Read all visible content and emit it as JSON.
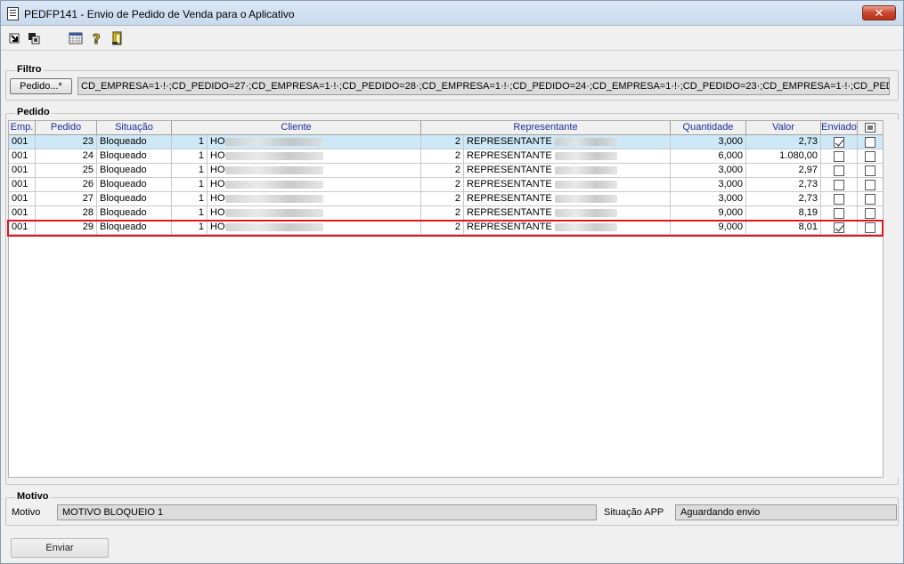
{
  "window": {
    "title": "PEDFP141 - Envio de Pedido de Venda para o Aplicativo",
    "close_label": "✕"
  },
  "toolbar": {
    "icons": [
      "arrow-in-icon",
      "copy-icon",
      "calendar-grid-icon",
      "help-icon",
      "exit-door-icon"
    ]
  },
  "filtro": {
    "group_label": "Filtro",
    "button_label": "Pedido...*",
    "value": "CD_EMPRESA=1·!·;CD_PEDIDO=27·;CD_EMPRESA=1·!·;CD_PEDIDO=28·;CD_EMPRESA=1·!·;CD_PEDIDO=24·;CD_EMPRESA=1·!·;CD_PEDIDO=23·;CD_EMPRESA=1·!·;CD_PEDIDO=26·;CD_EMI"
  },
  "pedido": {
    "group_label": "Pedido",
    "columns": [
      "Emp.",
      "Pedido",
      "Situação",
      "Cliente",
      "Representante",
      "Quantidade",
      "Valor",
      "Enviado",
      ""
    ],
    "rows": [
      {
        "emp": "001",
        "pedido": "23",
        "situacao": "Bloqueado",
        "cliente_cod": "1",
        "cliente_nome": "HO",
        "rep_cod": "2",
        "rep_nome": "REPRESENTANTE ",
        "quantidade": "3,000",
        "valor": "2,73",
        "enviado": true,
        "selecionado": false
      },
      {
        "emp": "001",
        "pedido": "24",
        "situacao": "Bloqueado",
        "cliente_cod": "1",
        "cliente_nome": "HO",
        "rep_cod": "2",
        "rep_nome": "REPRESENTANTE ",
        "quantidade": "6,000",
        "valor": "1.080,00",
        "enviado": false,
        "selecionado": false
      },
      {
        "emp": "001",
        "pedido": "25",
        "situacao": "Bloqueado",
        "cliente_cod": "1",
        "cliente_nome": "HO",
        "rep_cod": "2",
        "rep_nome": "REPRESENTANTE ",
        "quantidade": "3,000",
        "valor": "2,97",
        "enviado": false,
        "selecionado": false
      },
      {
        "emp": "001",
        "pedido": "26",
        "situacao": "Bloqueado",
        "cliente_cod": "1",
        "cliente_nome": "HO",
        "rep_cod": "2",
        "rep_nome": "REPRESENTANTE ",
        "quantidade": "3,000",
        "valor": "2,73",
        "enviado": false,
        "selecionado": false
      },
      {
        "emp": "001",
        "pedido": "27",
        "situacao": "Bloqueado",
        "cliente_cod": "1",
        "cliente_nome": "HO",
        "rep_cod": "2",
        "rep_nome": "REPRESENTANTE ",
        "quantidade": "3,000",
        "valor": "2,73",
        "enviado": false,
        "selecionado": false
      },
      {
        "emp": "001",
        "pedido": "28",
        "situacao": "Bloqueado",
        "cliente_cod": "1",
        "cliente_nome": "HO",
        "rep_cod": "2",
        "rep_nome": "REPRESENTANTE ",
        "quantidade": "9,000",
        "valor": "8,19",
        "enviado": false,
        "selecionado": false
      },
      {
        "emp": "001",
        "pedido": "29",
        "situacao": "Bloqueado",
        "cliente_cod": "1",
        "cliente_nome": "HO",
        "rep_cod": "2",
        "rep_nome": "REPRESENTANTE ",
        "quantidade": "9,000",
        "valor": "8,01",
        "enviado": true,
        "selecionado": false
      }
    ]
  },
  "motivo": {
    "group_label": "Motivo",
    "label": "Motivo",
    "value": "MOTIVO BLOQUEIO 1",
    "situacao_label": "Situação APP",
    "situacao_value": "Aguardando envio"
  },
  "actions": {
    "enviar_label": "Enviar"
  },
  "colors": {
    "header_text": "#1a2d9c",
    "selected_row": "#cde8f6",
    "highlight_border": "#e0141e",
    "close_button": "#c9462c"
  }
}
